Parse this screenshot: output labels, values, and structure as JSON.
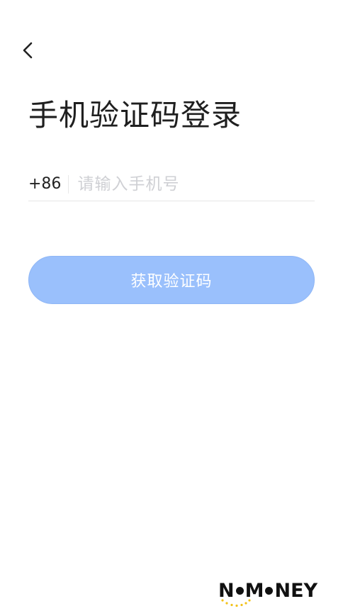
{
  "header": {
    "back_icon": "chevron-left-icon"
  },
  "page": {
    "title": "手机验证码登录"
  },
  "phone": {
    "country_code": "+86",
    "value": "",
    "placeholder": "请输入手机号"
  },
  "actions": {
    "get_code_label": "获取验证码"
  },
  "colors": {
    "primary_button": "#9ac0fc",
    "placeholder": "#cfd0d4",
    "divider": "#e6e6e6",
    "brand_accent": "#f2c21b"
  },
  "brand": {
    "part1": "N",
    "part2": "M",
    "part3": "NEY"
  }
}
